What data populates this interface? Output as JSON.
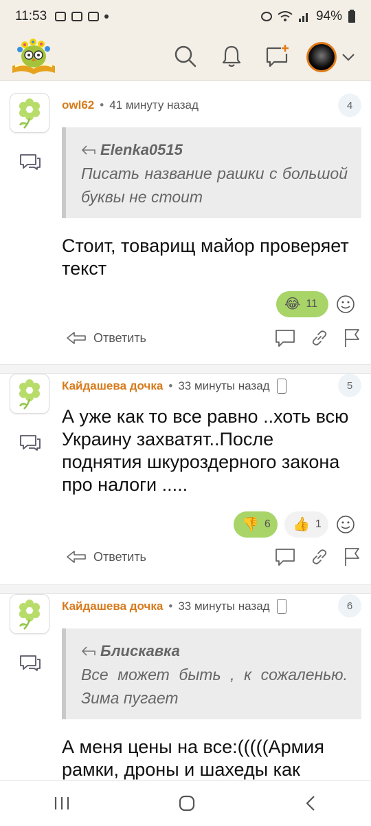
{
  "status": {
    "time": "11:53",
    "battery": "94%"
  },
  "header": {
    "logo_icon": "book-owl-logo",
    "search_icon": "search-icon",
    "bell_icon": "bell-icon",
    "new_post_icon": "add-comment-icon"
  },
  "comments": [
    {
      "author": "owl62",
      "time": "41 минуту назад",
      "number": "4",
      "quote": {
        "author": "Elenka0515",
        "text": "Писать название рашки с большой буквы не стоит"
      },
      "text": "Стоит, товарищ майор проверяет текст",
      "reactions": [
        {
          "emoji": "😂",
          "count": "11",
          "style": "green"
        }
      ],
      "reply_label": "Ответить"
    },
    {
      "author": "Кайдашева дочка",
      "time": "33 минуты назад",
      "number": "5",
      "text": "А уже как то все равно ..хоть всю Украину захватят..После поднятия шкуроздерного закона про налоги .....",
      "reactions": [
        {
          "emoji": "👎",
          "count": "6",
          "style": "green"
        },
        {
          "emoji": "👍",
          "count": "1",
          "style": "plain"
        }
      ],
      "reply_label": "Ответить"
    },
    {
      "author": "Кайдашева дочка",
      "time": "33 минуты назад",
      "number": "6",
      "quote": {
        "author": "Блискавка",
        "text": "Все может быть , к сожаленью. Зима пугает"
      },
      "text": "А меня цены на все:(((((Армия рамки, дроны и шахеды как"
    }
  ],
  "colors": {
    "accent": "#d77a1b",
    "reaction_green": "#a8d468",
    "header_bg": "#f3efe6"
  }
}
